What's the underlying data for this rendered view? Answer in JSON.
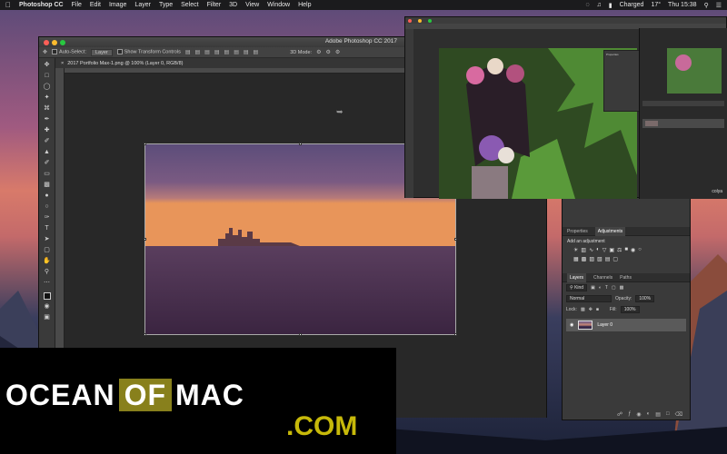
{
  "menubar": {
    "app_name": "Photoshop CC",
    "menus": [
      "File",
      "Edit",
      "Image",
      "Layer",
      "Type",
      "Select",
      "Filter",
      "3D",
      "View",
      "Window",
      "Help"
    ],
    "battery": "Charged",
    "temperature": "17°",
    "clock": "Thu 15:38"
  },
  "window": {
    "title": "Adobe Photoshop CC 2017",
    "options": {
      "auto_select": "Auto-Select:",
      "auto_select_value": "Layer",
      "show_transform": "Show Transform Controls",
      "mode_3d": "3D Mode:"
    },
    "document_tab": "2017 Portfolio Max-1.png @ 100% (Layer 0, RGB/8)"
  },
  "second_window": {
    "watermark": "colya",
    "properties_title": "Properties"
  },
  "panels": {
    "properties_tab": "Properties",
    "adjustments_tab": "Adjustments",
    "add_adjustment": "Add an adjustment",
    "layers_tab": "Layers",
    "channels_tab": "Channels",
    "paths_tab": "Paths",
    "kind": "Kind",
    "blend_mode": "Normal",
    "opacity_label": "Opacity:",
    "opacity_value": "100%",
    "lock_label": "Lock:",
    "fill_label": "Fill:",
    "fill_value": "100%",
    "layer_name": "Layer 0"
  },
  "watermark": {
    "ocean": "OCEAN",
    "of": "OF",
    "mac": "MAC",
    "com": ".COM"
  },
  "colors": {
    "accent_olive": "#88801c",
    "accent_gold": "#c7b90a"
  }
}
